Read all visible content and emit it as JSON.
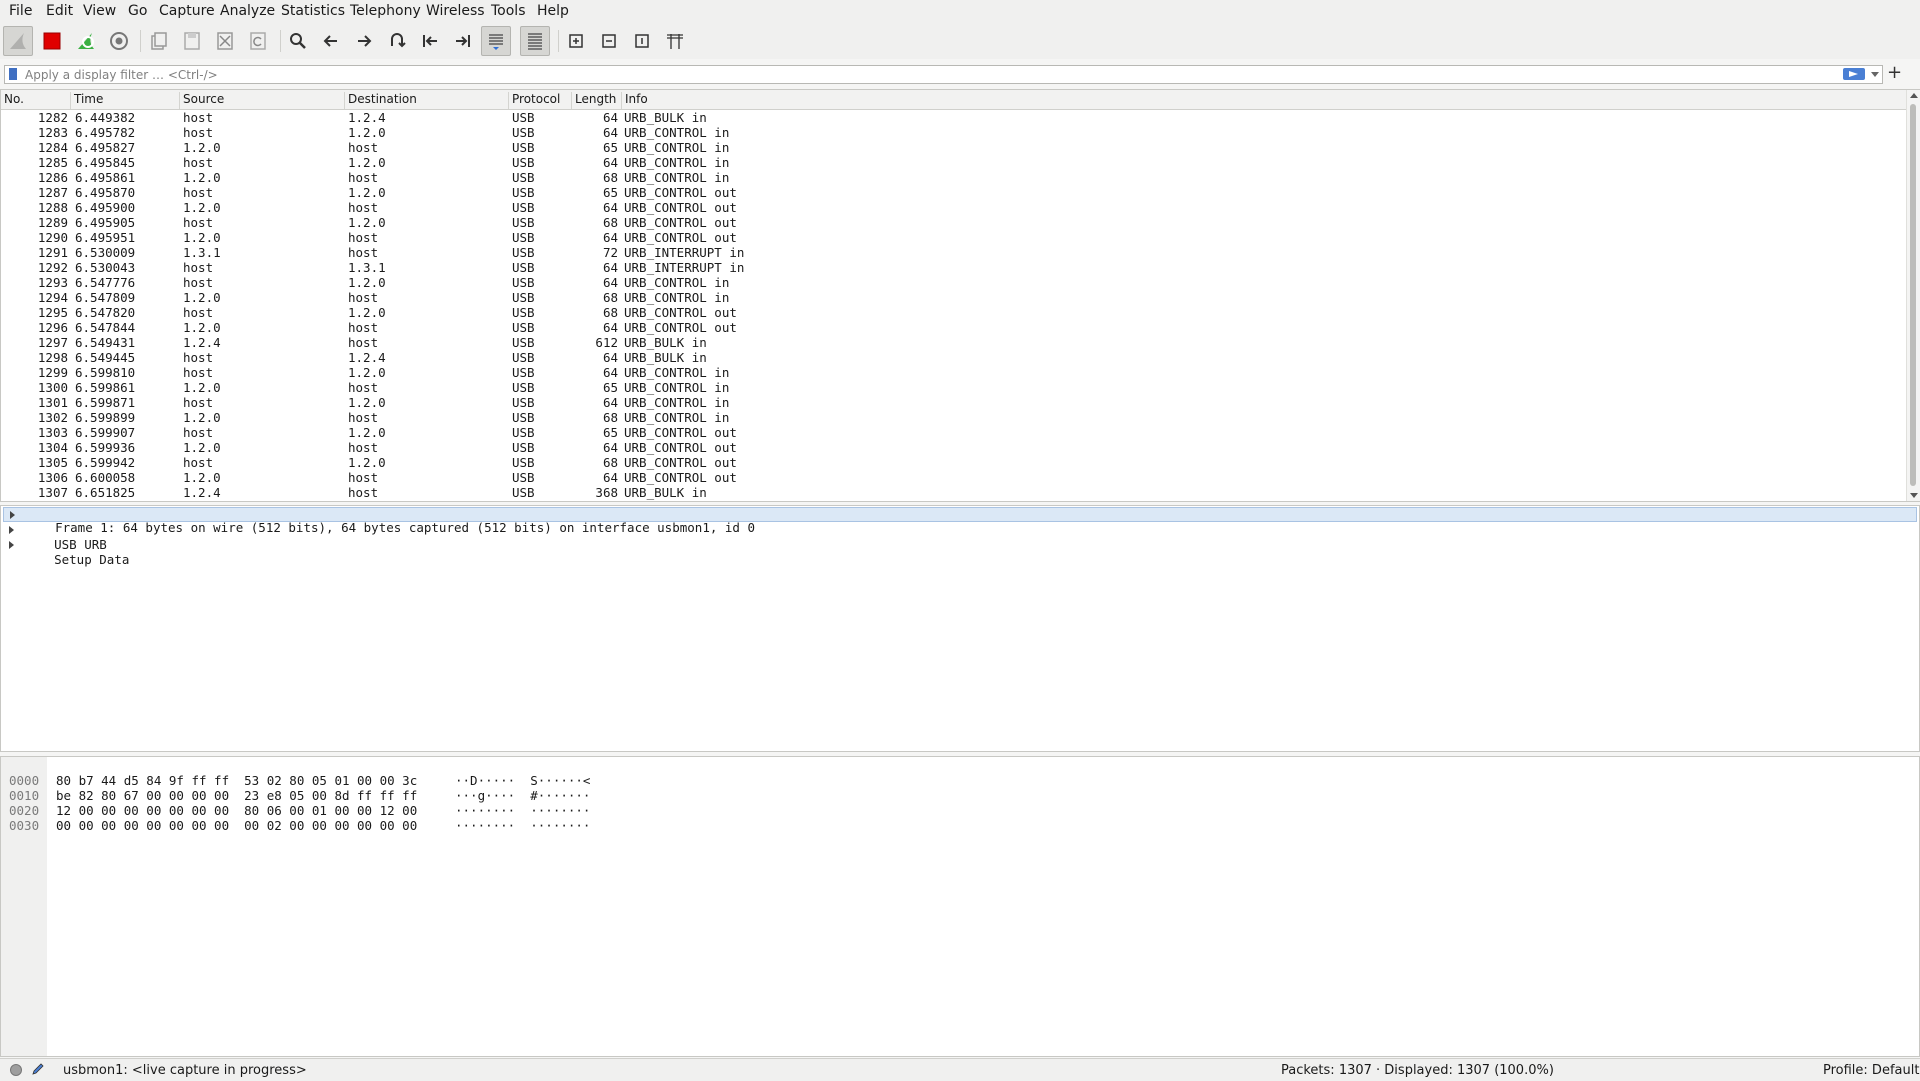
{
  "menu": [
    "File",
    "Edit",
    "View",
    "Go",
    "Capture",
    "Analyze",
    "Statistics",
    "Telephony",
    "Wireless",
    "Tools",
    "Help"
  ],
  "filter": {
    "placeholder": "Apply a display filter … <Ctrl-/>",
    "value": "",
    "add_label": "+"
  },
  "columns": [
    "No.",
    "Time",
    "Source",
    "Destination",
    "Protocol",
    "Length",
    "Info"
  ],
  "packets": [
    [
      "1282",
      "6.449382",
      "host",
      "1.2.4",
      "USB",
      "64",
      "URB_BULK in"
    ],
    [
      "1283",
      "6.495782",
      "host",
      "1.2.0",
      "USB",
      "64",
      "URB_CONTROL in"
    ],
    [
      "1284",
      "6.495827",
      "1.2.0",
      "host",
      "USB",
      "65",
      "URB_CONTROL in"
    ],
    [
      "1285",
      "6.495845",
      "host",
      "1.2.0",
      "USB",
      "64",
      "URB_CONTROL in"
    ],
    [
      "1286",
      "6.495861",
      "1.2.0",
      "host",
      "USB",
      "68",
      "URB_CONTROL in"
    ],
    [
      "1287",
      "6.495870",
      "host",
      "1.2.0",
      "USB",
      "65",
      "URB_CONTROL out"
    ],
    [
      "1288",
      "6.495900",
      "1.2.0",
      "host",
      "USB",
      "64",
      "URB_CONTROL out"
    ],
    [
      "1289",
      "6.495905",
      "host",
      "1.2.0",
      "USB",
      "68",
      "URB_CONTROL out"
    ],
    [
      "1290",
      "6.495951",
      "1.2.0",
      "host",
      "USB",
      "64",
      "URB_CONTROL out"
    ],
    [
      "1291",
      "6.530009",
      "1.3.1",
      "host",
      "USB",
      "72",
      "URB_INTERRUPT in"
    ],
    [
      "1292",
      "6.530043",
      "host",
      "1.3.1",
      "USB",
      "64",
      "URB_INTERRUPT in"
    ],
    [
      "1293",
      "6.547776",
      "host",
      "1.2.0",
      "USB",
      "64",
      "URB_CONTROL in"
    ],
    [
      "1294",
      "6.547809",
      "1.2.0",
      "host",
      "USB",
      "68",
      "URB_CONTROL in"
    ],
    [
      "1295",
      "6.547820",
      "host",
      "1.2.0",
      "USB",
      "68",
      "URB_CONTROL out"
    ],
    [
      "1296",
      "6.547844",
      "1.2.0",
      "host",
      "USB",
      "64",
      "URB_CONTROL out"
    ],
    [
      "1297",
      "6.549431",
      "1.2.4",
      "host",
      "USB",
      "612",
      "URB_BULK in"
    ],
    [
      "1298",
      "6.549445",
      "host",
      "1.2.4",
      "USB",
      "64",
      "URB_BULK in"
    ],
    [
      "1299",
      "6.599810",
      "host",
      "1.2.0",
      "USB",
      "64",
      "URB_CONTROL in"
    ],
    [
      "1300",
      "6.599861",
      "1.2.0",
      "host",
      "USB",
      "65",
      "URB_CONTROL in"
    ],
    [
      "1301",
      "6.599871",
      "host",
      "1.2.0",
      "USB",
      "64",
      "URB_CONTROL in"
    ],
    [
      "1302",
      "6.599899",
      "1.2.0",
      "host",
      "USB",
      "68",
      "URB_CONTROL in"
    ],
    [
      "1303",
      "6.599907",
      "host",
      "1.2.0",
      "USB",
      "65",
      "URB_CONTROL out"
    ],
    [
      "1304",
      "6.599936",
      "1.2.0",
      "host",
      "USB",
      "64",
      "URB_CONTROL out"
    ],
    [
      "1305",
      "6.599942",
      "host",
      "1.2.0",
      "USB",
      "68",
      "URB_CONTROL out"
    ],
    [
      "1306",
      "6.600058",
      "1.2.0",
      "host",
      "USB",
      "64",
      "URB_CONTROL out"
    ],
    [
      "1307",
      "6.651825",
      "1.2.4",
      "host",
      "USB",
      "368",
      "URB_BULK in"
    ]
  ],
  "details": [
    "Frame 1: 64 bytes on wire (512 bits), 64 bytes captured (512 bits) on interface usbmon1, id 0",
    "USB URB",
    "Setup Data"
  ],
  "bytes": [
    {
      "offset": "0000",
      "hex": "80 b7 44 d5 84 9f ff ff  53 02 80 05 01 00 00 3c",
      "ascii": "··D·····  S······<"
    },
    {
      "offset": "0010",
      "hex": "be 82 80 67 00 00 00 00  23 e8 05 00 8d ff ff ff",
      "ascii": "···g····  #·······"
    },
    {
      "offset": "0020",
      "hex": "12 00 00 00 00 00 00 00  80 06 00 01 00 00 12 00",
      "ascii": "········  ········"
    },
    {
      "offset": "0030",
      "hex": "00 00 00 00 00 00 00 00  00 02 00 00 00 00 00 00",
      "ascii": "········  ········"
    }
  ],
  "status": {
    "capture": "usbmon1: <live capture in progress>",
    "packets": "Packets: 1307 · Displayed: 1307 (100.0%)",
    "profile": "Profile: Default"
  }
}
